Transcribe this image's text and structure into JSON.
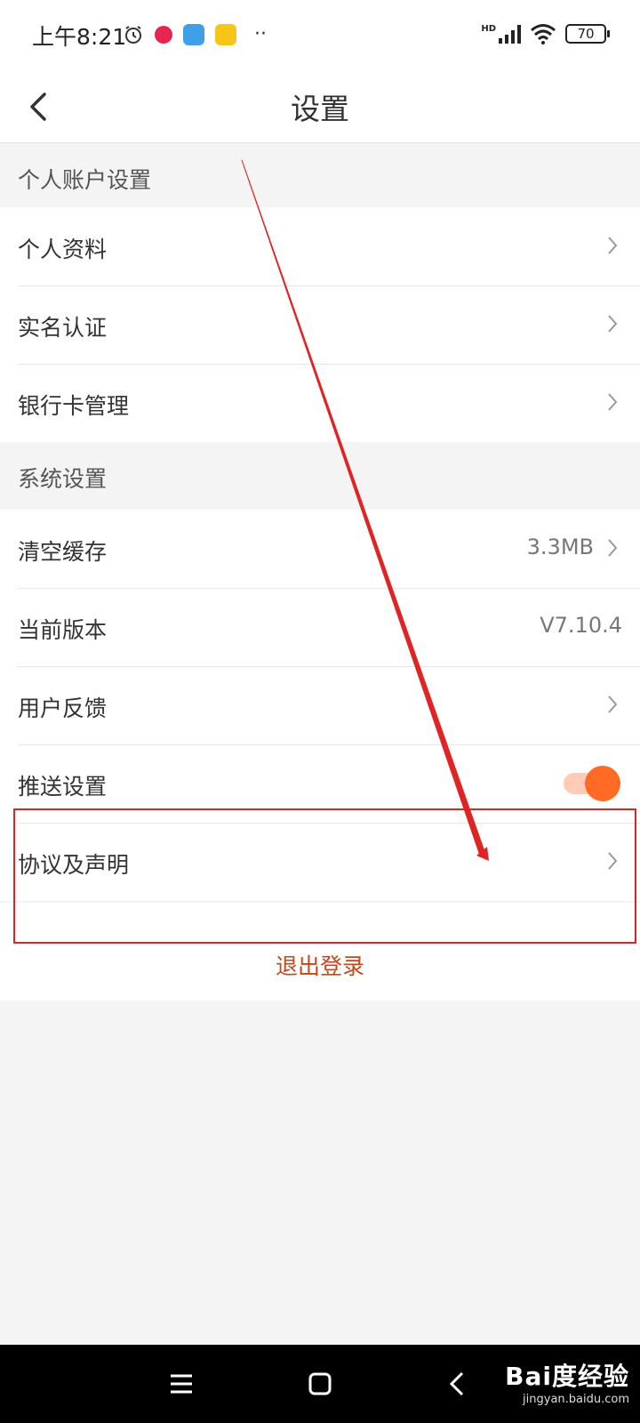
{
  "status_bar": {
    "time": "上午8:21",
    "battery": "70",
    "network": "HD",
    "app_icons": [
      "alarm-icon",
      "video-app-icon",
      "paper-plane-app-icon",
      "weibo-app-icon",
      "more-dots-icon"
    ]
  },
  "header": {
    "title": "设置",
    "back_icon": "chevron-left-icon"
  },
  "sections": [
    {
      "title": "个人账户设置",
      "items": [
        {
          "label": "个人资料"
        },
        {
          "label": "实名认证"
        },
        {
          "label": "银行卡管理"
        }
      ]
    },
    {
      "title": "系统设置",
      "items": [
        {
          "label": "清空缓存",
          "value": "3.3MB"
        },
        {
          "label": "当前版本",
          "value": "V7.10.4"
        },
        {
          "label": "用户反馈"
        },
        {
          "label": "推送设置",
          "toggle_on": true
        },
        {
          "label": "协议及声明"
        }
      ]
    }
  ],
  "logout_label": "退出登录",
  "watermark": {
    "brand": "Bai度经验",
    "url": "jingyan.baidu.com"
  },
  "colors": {
    "accent": "#ff6a24",
    "logout_text": "#c9461b",
    "annotation": "#e02424",
    "page_bg": "#f4f4f4"
  }
}
